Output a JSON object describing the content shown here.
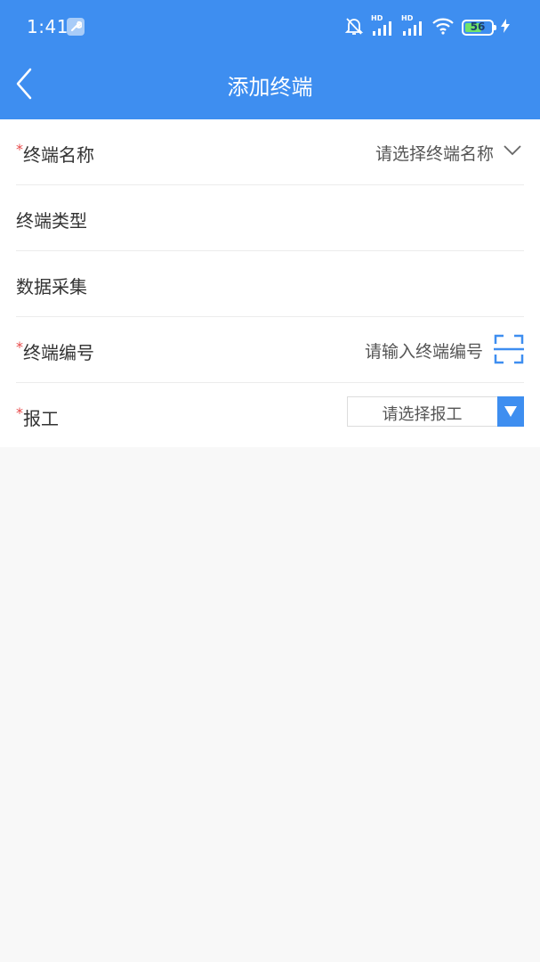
{
  "status_bar": {
    "time": "1:41",
    "battery": "56",
    "hd1": "HD",
    "hd2": "HD"
  },
  "header": {
    "title": "添加终端"
  },
  "form": {
    "terminal_name": {
      "required_mark": "*",
      "label": "终端名称",
      "placeholder": "请选择终端名称"
    },
    "terminal_type": {
      "label": "终端类型"
    },
    "data_collection": {
      "label": "数据采集"
    },
    "terminal_number": {
      "required_mark": "*",
      "label": "终端编号",
      "placeholder": "请输入终端编号"
    },
    "report_work": {
      "required_mark": "*",
      "label": "报工",
      "select_value": "请选择报工"
    }
  },
  "colors": {
    "primary": "#3e8ef0",
    "required": "#e84a4a",
    "background": "#f8f8f8"
  }
}
